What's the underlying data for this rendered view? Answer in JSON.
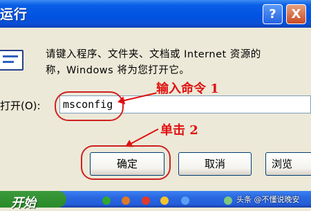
{
  "window": {
    "title": "运行",
    "help_label": "?",
    "close_label": "X"
  },
  "dialog": {
    "description_line1": "请键入程序、文件夹、文档或 Internet 资源的",
    "description_line2": "称，Windows 将为您打开它。",
    "open_label": "打开(O):",
    "command_value": "msconfig",
    "buttons": {
      "ok": "确定",
      "cancel": "取消",
      "browse": "浏览"
    }
  },
  "annotations": {
    "step1": "输入命令 1",
    "step2": "单击 2",
    "color": "#e01010"
  },
  "taskbar": {
    "start_label": "开始",
    "watermark": "头条 @不懂说晚安"
  }
}
